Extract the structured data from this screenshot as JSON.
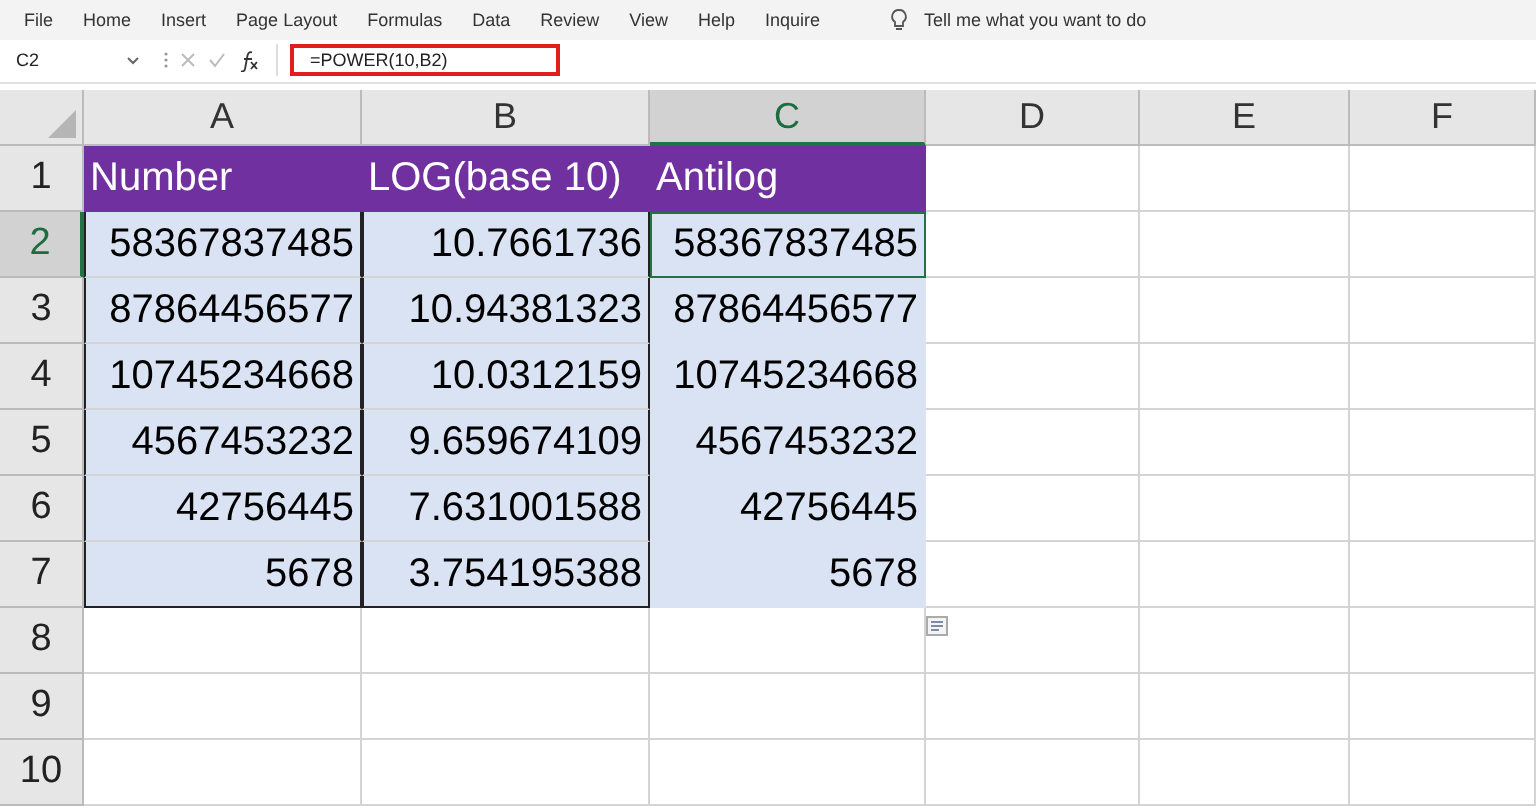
{
  "menu": [
    {
      "label": "File"
    },
    {
      "label": "Home"
    },
    {
      "label": "Insert"
    },
    {
      "label": "Page Layout"
    },
    {
      "label": "Formulas"
    },
    {
      "label": "Data"
    },
    {
      "label": "Review"
    },
    {
      "label": "View"
    },
    {
      "label": "Help"
    },
    {
      "label": "Inquire"
    }
  ],
  "tell_me": "Tell me what you want to do",
  "name_box": "C2",
  "formula": "=POWER(10,B2)",
  "columns": [
    {
      "label": "A",
      "selected": false
    },
    {
      "label": "B",
      "selected": false
    },
    {
      "label": "C",
      "selected": true
    },
    {
      "label": "D",
      "selected": false
    },
    {
      "label": "E",
      "selected": false
    },
    {
      "label": "F",
      "selected": false
    }
  ],
  "rows": [
    {
      "label": "1",
      "selected": false,
      "cells": [
        {
          "text": "Number",
          "kind": "header",
          "selected": false
        },
        {
          "text": "LOG(base 10)",
          "kind": "header",
          "selected": false
        },
        {
          "text": "Antilog",
          "kind": "header",
          "selected": false
        }
      ]
    },
    {
      "label": "2",
      "selected": true,
      "cells": [
        {
          "text": "58367837485",
          "kind": "boxed",
          "selected": false
        },
        {
          "text": "10.7661736",
          "kind": "boxed",
          "selected": false
        },
        {
          "text": "58367837485",
          "kind": "shaded",
          "selected": true
        }
      ]
    },
    {
      "label": "3",
      "selected": false,
      "cells": [
        {
          "text": "87864456577",
          "kind": "boxed",
          "selected": false
        },
        {
          "text": "10.94381323",
          "kind": "boxed",
          "selected": false
        },
        {
          "text": "87864456577",
          "kind": "shaded",
          "selected": false
        }
      ]
    },
    {
      "label": "4",
      "selected": false,
      "cells": [
        {
          "text": "10745234668",
          "kind": "boxed",
          "selected": false
        },
        {
          "text": "10.0312159",
          "kind": "boxed",
          "selected": false
        },
        {
          "text": "10745234668",
          "kind": "shaded",
          "selected": false
        }
      ]
    },
    {
      "label": "5",
      "selected": false,
      "cells": [
        {
          "text": "4567453232",
          "kind": "boxed",
          "selected": false
        },
        {
          "text": "9.659674109",
          "kind": "boxed",
          "selected": false
        },
        {
          "text": "4567453232",
          "kind": "shaded",
          "selected": false
        }
      ]
    },
    {
      "label": "6",
      "selected": false,
      "cells": [
        {
          "text": "42756445",
          "kind": "boxed",
          "selected": false
        },
        {
          "text": "7.631001588",
          "kind": "boxed",
          "selected": false
        },
        {
          "text": "42756445",
          "kind": "shaded",
          "selected": false
        }
      ]
    },
    {
      "label": "7",
      "selected": false,
      "cells": [
        {
          "text": "5678",
          "kind": "boxed",
          "selected": false
        },
        {
          "text": "3.754195388",
          "kind": "boxed",
          "selected": false
        },
        {
          "text": "5678",
          "kind": "shaded",
          "selected": false
        }
      ]
    },
    {
      "label": "8",
      "selected": false,
      "cells": []
    },
    {
      "label": "9",
      "selected": false,
      "cells": []
    },
    {
      "label": "10",
      "selected": false,
      "cells": []
    }
  ]
}
